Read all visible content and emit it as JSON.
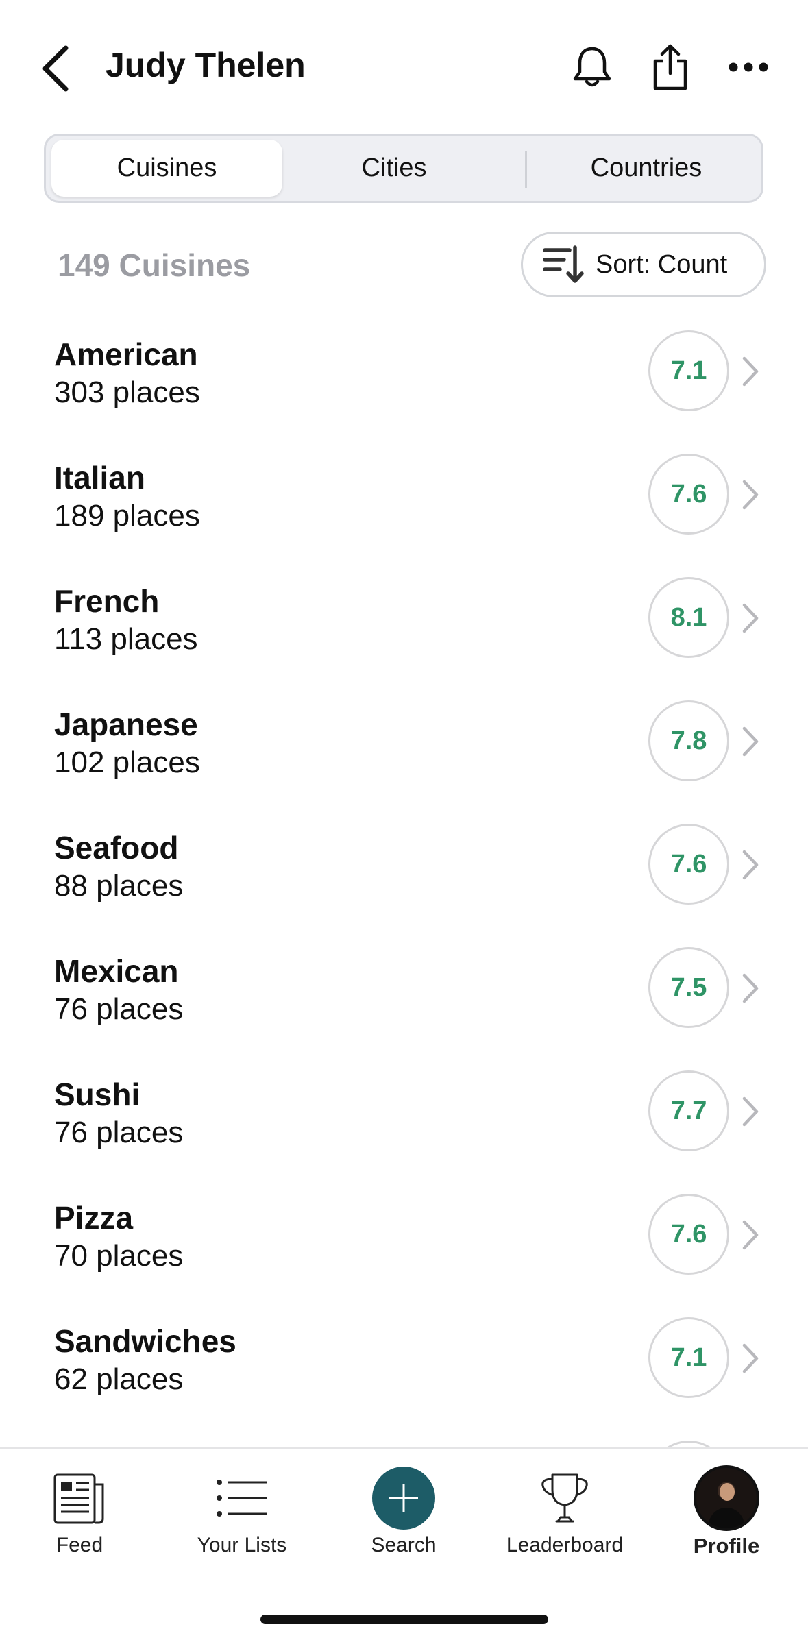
{
  "header": {
    "title": "Judy Thelen",
    "back_icon": "chevron-left-icon",
    "bell_icon": "bell-icon",
    "share_icon": "share-icon",
    "more_icon": "more-horizontal-icon"
  },
  "segments": {
    "items": [
      "Cuisines",
      "Cities",
      "Countries"
    ],
    "selected": "Cuisines"
  },
  "summary": {
    "count_label": "149 Cuisines",
    "sort_label": "Sort: Count",
    "sort_icon": "sort-descending-icon"
  },
  "cuisines": [
    {
      "name": "American",
      "count": "303 places",
      "score": "7.1"
    },
    {
      "name": "Italian",
      "count": "189 places",
      "score": "7.6"
    },
    {
      "name": "French",
      "count": "113 places",
      "score": "8.1"
    },
    {
      "name": "Japanese",
      "count": "102 places",
      "score": "7.8"
    },
    {
      "name": "Seafood",
      "count": "88 places",
      "score": "7.6"
    },
    {
      "name": "Mexican",
      "count": "76 places",
      "score": "7.5"
    },
    {
      "name": "Sushi",
      "count": "76 places",
      "score": "7.7"
    },
    {
      "name": "Pizza",
      "count": "70 places",
      "score": "7.6"
    },
    {
      "name": "Sandwiches",
      "count": "62 places",
      "score": "7.1"
    }
  ],
  "tabbar": {
    "items": [
      {
        "label": "Feed",
        "icon": "newspaper-icon"
      },
      {
        "label": "Your Lists",
        "icon": "list-icon"
      },
      {
        "label": "Search",
        "icon": "plus-icon"
      },
      {
        "label": "Leaderboard",
        "icon": "trophy-icon"
      },
      {
        "label": "Profile",
        "icon": "avatar"
      }
    ],
    "active": "Profile"
  },
  "colors": {
    "score_text": "#2f9466",
    "accent": "#1d5c67",
    "muted_text": "#9b9ca2"
  }
}
